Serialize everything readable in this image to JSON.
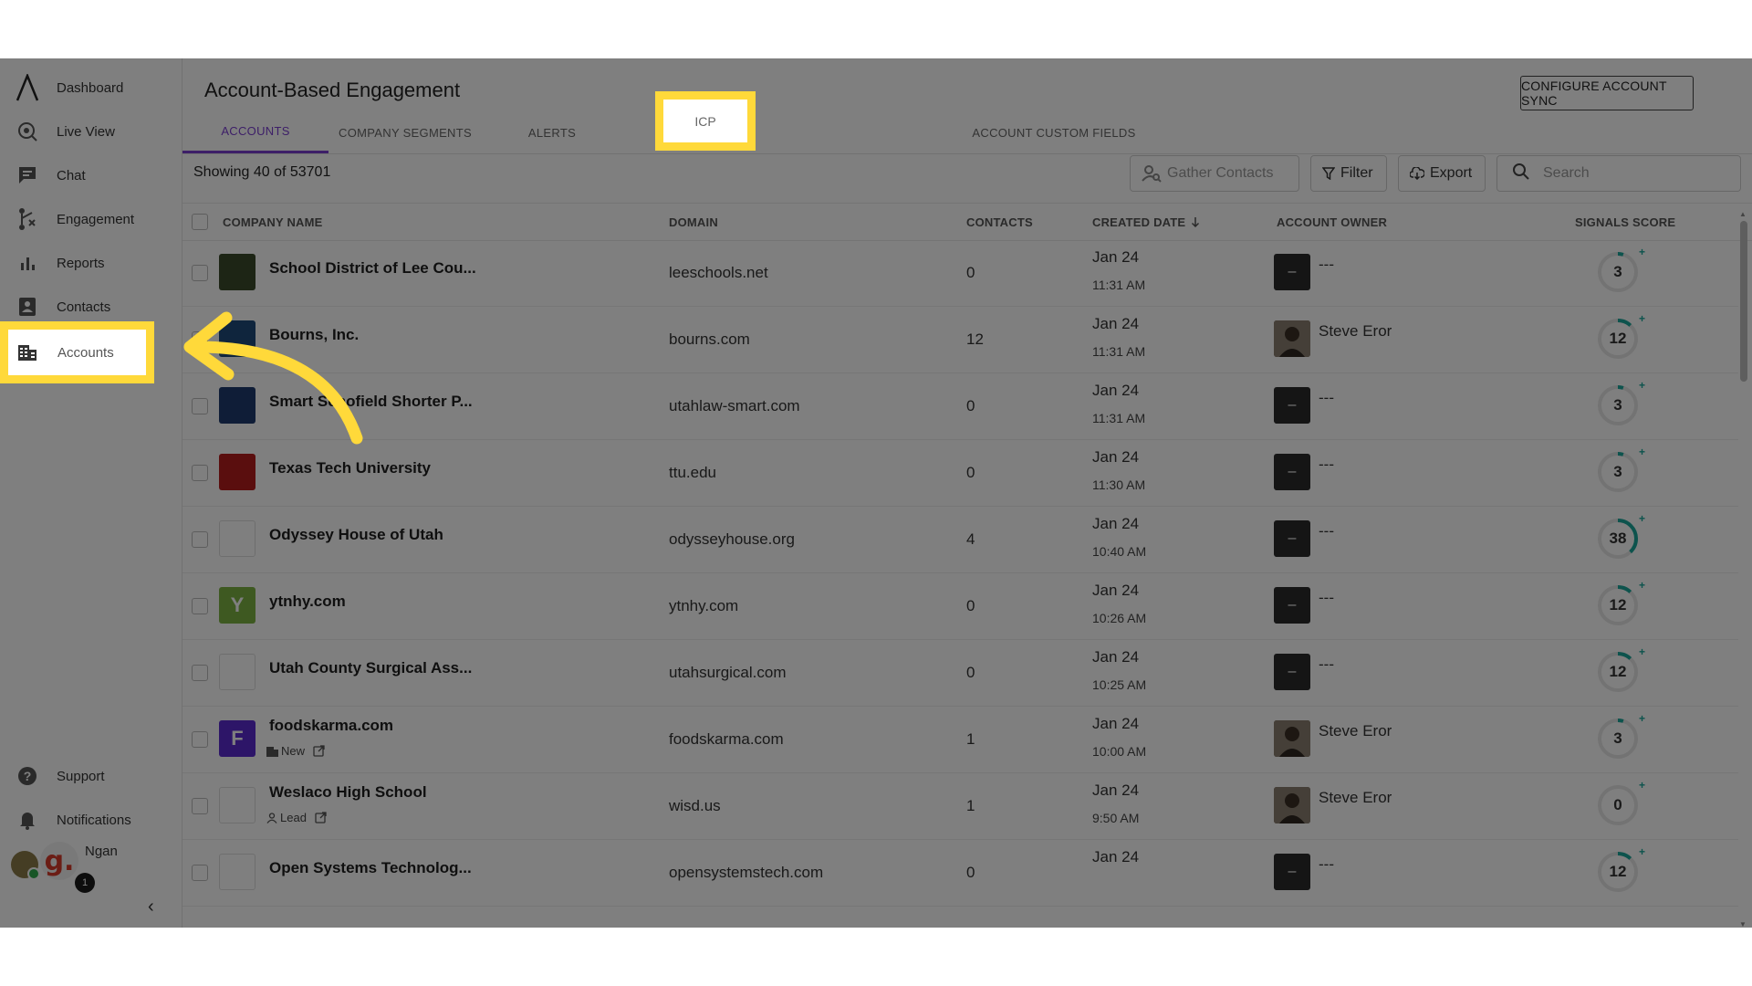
{
  "sidebar": {
    "items": [
      {
        "label": "Dashboard",
        "icon": "logo-caret-icon"
      },
      {
        "label": "Live View",
        "icon": "live-view-icon"
      },
      {
        "label": "Chat",
        "icon": "chat-icon"
      },
      {
        "label": "Engagement",
        "icon": "engagement-icon"
      },
      {
        "label": "Reports",
        "icon": "bar-chart-icon"
      },
      {
        "label": "Contacts",
        "icon": "contacts-icon"
      },
      {
        "label": "Accounts",
        "icon": "building-icon",
        "active": true
      }
    ],
    "bottom": [
      {
        "label": "Support",
        "icon": "help-icon"
      },
      {
        "label": "Notifications",
        "icon": "bell-icon"
      }
    ],
    "user": {
      "name": "Ngan",
      "initial": "g.",
      "badge": "1"
    },
    "collapse_icon": "chevron-left-icon"
  },
  "header": {
    "title": "Account-Based Engagement",
    "configure_button": "CONFIGURE ACCOUNT SYNC",
    "tabs": [
      {
        "label": "ACCOUNTS",
        "active": true
      },
      {
        "label": "COMPANY SEGMENTS"
      },
      {
        "label": "ALERTS"
      },
      {
        "label": "ICP",
        "highlighted": true
      },
      {
        "label": "ACCOUNT CUSTOM FIELDS"
      }
    ]
  },
  "toolbar": {
    "showing": "Showing 40 of  53701",
    "gather_contacts": "Gather Contacts",
    "filter": "Filter",
    "export": "Export",
    "search_placeholder": "Search"
  },
  "table": {
    "columns": [
      "COMPANY NAME",
      "DOMAIN",
      "CONTACTS",
      "CREATED DATE",
      "ACCOUNT OWNER",
      "SIGNALS SCORE"
    ],
    "sort_icon": "arrow-down-icon",
    "rows": [
      {
        "name": "School District of Lee Cou...",
        "domain": "leeschools.net",
        "contacts": "0",
        "date": "Jan 24",
        "time": "11:31 AM",
        "owner": "---",
        "score": "3",
        "logo_color": "#3a4a2a"
      },
      {
        "name": "Bourns, Inc.",
        "domain": "bourns.com",
        "contacts": "12",
        "date": "Jan 24",
        "time": "11:31 AM",
        "owner": "Steve Eror",
        "score": "12",
        "logo_color": "#1f4a7a"
      },
      {
        "name": "Smart Schofield Shorter P...",
        "domain": "utahlaw-smart.com",
        "contacts": "0",
        "date": "Jan 24",
        "time": "11:31 AM",
        "owner": "---",
        "score": "3",
        "logo_color": "#1e3a6e"
      },
      {
        "name": "Texas Tech University",
        "domain": "ttu.edu",
        "contacts": "0",
        "date": "Jan 24",
        "time": "11:30 AM",
        "owner": "---",
        "score": "3",
        "logo_color": "#b41d1d"
      },
      {
        "name": "Odyssey House of Utah",
        "domain": "odysseyhouse.org",
        "contacts": "4",
        "date": "Jan 24",
        "time": "10:40 AM",
        "owner": "---",
        "score": "38",
        "logo_color": "#ffffff"
      },
      {
        "name": "ytnhy.com",
        "domain": "ytnhy.com",
        "contacts": "0",
        "date": "Jan 24",
        "time": "10:26 AM",
        "owner": "---",
        "score": "12",
        "logo_color": "#7cb342",
        "logo_letter": "Y"
      },
      {
        "name": "Utah County Surgical Ass...",
        "domain": "utahsurgical.com",
        "contacts": "0",
        "date": "Jan 24",
        "time": "10:25 AM",
        "owner": "---",
        "score": "12",
        "logo_color": "#ffffff"
      },
      {
        "name": "foodskarma.com",
        "domain": "foodskarma.com",
        "contacts": "1",
        "date": "Jan 24",
        "time": "10:00 AM",
        "owner": "Steve Eror",
        "score": "3",
        "logo_color": "#5b2bd1",
        "logo_letter": "F",
        "tag": "New"
      },
      {
        "name": "Weslaco High School",
        "domain": "wisd.us",
        "contacts": "1",
        "date": "Jan 24",
        "time": "9:50 AM",
        "owner": "Steve Eror",
        "score": "0",
        "logo_color": "#ffffff",
        "tag": "Lead"
      },
      {
        "name": "Open Systems Technolog...",
        "domain": "opensystemstech.com",
        "contacts": "0",
        "date": "Jan 24",
        "time": "",
        "owner": "---",
        "score": "12",
        "logo_color": "#ffffff"
      }
    ]
  },
  "colors": {
    "accent": "#7b3fd1",
    "highlight": "#ffd93a",
    "score_ring": "#1aa79a"
  }
}
